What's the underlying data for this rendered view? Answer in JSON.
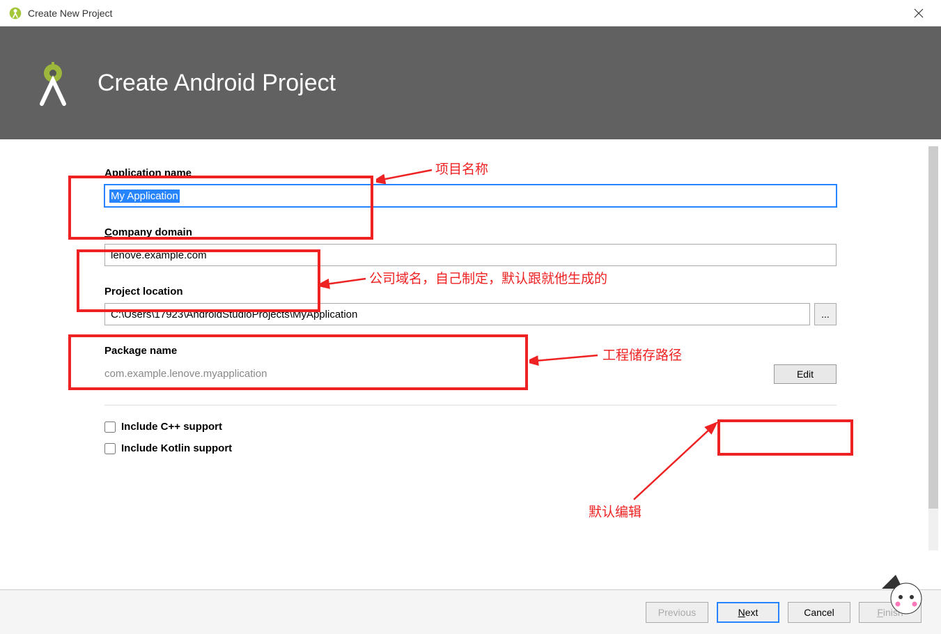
{
  "window": {
    "title": "Create New Project"
  },
  "header": {
    "title": "Create Android Project"
  },
  "fields": {
    "appName": {
      "label": "Application name",
      "value": "My Application"
    },
    "companyDomain": {
      "label": "Company domain",
      "value": "lenove.example.com"
    },
    "projectLocation": {
      "label": "Project location",
      "value": "C:\\Users\\17923\\AndroidStudioProjects\\MyApplication",
      "browse": "..."
    },
    "packageName": {
      "label": "Package name",
      "value": "com.example.lenove.myapplication",
      "editLabel": "Edit"
    }
  },
  "checkboxes": {
    "cpp": "Include C++ support",
    "kotlin": "Include Kotlin support"
  },
  "footer": {
    "previous": "Previous",
    "next": "Next",
    "cancel": "Cancel",
    "finish": "Finish"
  },
  "annotations": {
    "projectName": "项目名称",
    "companyDomain": "公司域名，自己制定，默认跟就他生成的",
    "projectPath": "工程储存路径",
    "defaultEdit": "默认编辑"
  }
}
